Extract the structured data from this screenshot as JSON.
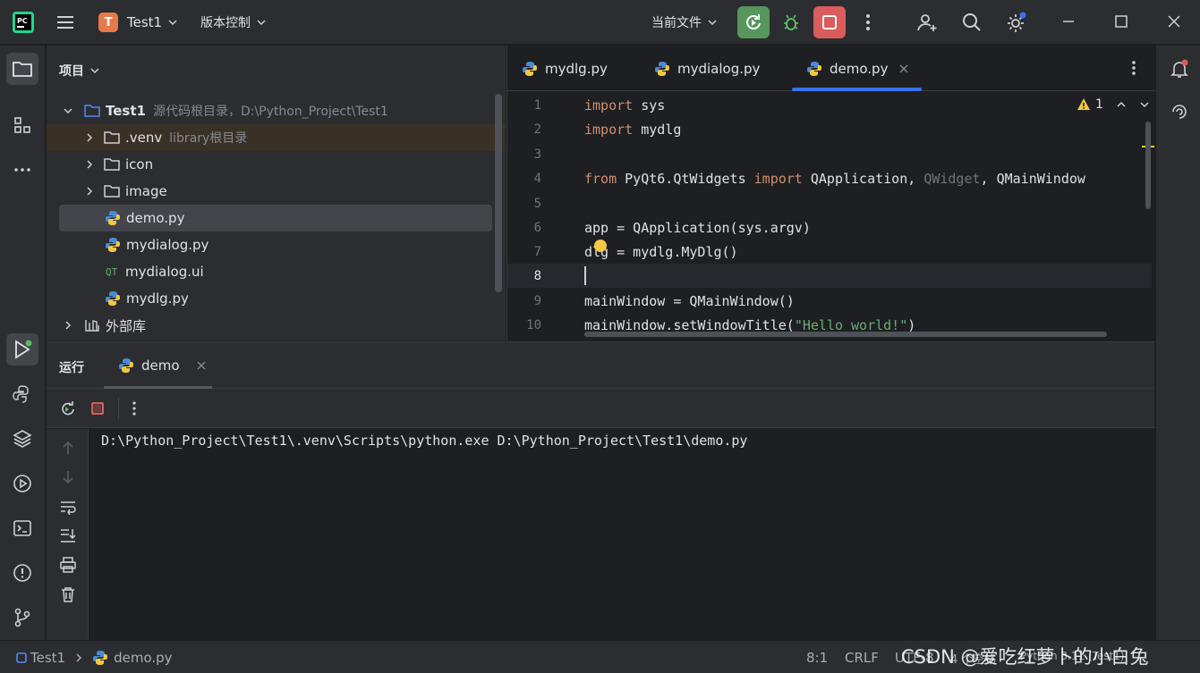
{
  "titlebar": {
    "project_badge": "T",
    "project_name": "Test1",
    "vcs_label": "版本控制",
    "run_config": "当前文件"
  },
  "project_panel": {
    "title": "项目",
    "tree": [
      {
        "label": "Test1",
        "hint": "源代码根目录，D:\\Python_Project\\Test1",
        "icon": "folder-icon",
        "expanded": true
      },
      {
        "label": ".venv",
        "hint": "library根目录",
        "icon": "folder-icon"
      },
      {
        "label": "icon",
        "hint": "",
        "icon": "folder-icon"
      },
      {
        "label": "image",
        "hint": "",
        "icon": "folder-icon"
      },
      {
        "label": "demo.py",
        "hint": "",
        "icon": "python-icon"
      },
      {
        "label": "mydialog.py",
        "hint": "",
        "icon": "python-icon"
      },
      {
        "label": "mydialog.ui",
        "hint": "",
        "icon": "qt-icon"
      },
      {
        "label": "mydlg.py",
        "hint": "",
        "icon": "python-icon"
      },
      {
        "label": "外部库",
        "hint": "",
        "icon": "library-icon"
      }
    ],
    "qt_glyph": "QT"
  },
  "editor": {
    "tabs": [
      {
        "label": "mydlg.py"
      },
      {
        "label": "mydialog.py"
      },
      {
        "label": "demo.py"
      }
    ],
    "warning_count": "1",
    "lines": [
      {
        "n": "1",
        "parts": [
          [
            "kw",
            "import"
          ],
          [
            "",
            " sys"
          ]
        ]
      },
      {
        "n": "2",
        "parts": [
          [
            "kw",
            "import"
          ],
          [
            "",
            " mydlg"
          ]
        ]
      },
      {
        "n": "3",
        "parts": []
      },
      {
        "n": "4",
        "parts": [
          [
            "kw",
            "from"
          ],
          [
            "",
            " PyQt6.QtWidgets "
          ],
          [
            "kw",
            "import"
          ],
          [
            "",
            " QApplication, "
          ],
          [
            "dim",
            "QWidget"
          ],
          [
            "",
            ", QMainWindow"
          ]
        ]
      },
      {
        "n": "5",
        "parts": []
      },
      {
        "n": "6",
        "parts": [
          [
            "",
            "app = QApplication(sys.argv)"
          ]
        ]
      },
      {
        "n": "7",
        "parts": [
          [
            "",
            "dlg = mydlg.MyDlg()"
          ]
        ]
      },
      {
        "n": "8",
        "parts": []
      },
      {
        "n": "9",
        "parts": [
          [
            "",
            "mainWindow = QMainWindow()"
          ]
        ]
      },
      {
        "n": "10",
        "parts": [
          [
            "",
            "mainWindow.setWindowTitle("
          ],
          [
            "str",
            "\"Hello world!\""
          ],
          [
            "",
            ")"
          ]
        ]
      }
    ]
  },
  "run_panel": {
    "title": "运行",
    "tab_label": "demo",
    "output": "D:\\Python_Project\\Test1\\.venv\\Scripts\\python.exe D:\\Python_Project\\Test1\\demo.py"
  },
  "statusbar": {
    "crumb_project": "Test1",
    "crumb_file": "demo.py",
    "position": "8:1",
    "line_sep": "CRLF",
    "encoding": "UTF-8",
    "indent": "4 个空格",
    "interpreter": "Python 3.11 (Test1)",
    "watermark": "CSDN @爱吃红萝卜的小白兔"
  },
  "colors": {
    "run_green": "#57965c",
    "stop_red": "#db5c5c",
    "accent_blue": "#3574f0"
  }
}
